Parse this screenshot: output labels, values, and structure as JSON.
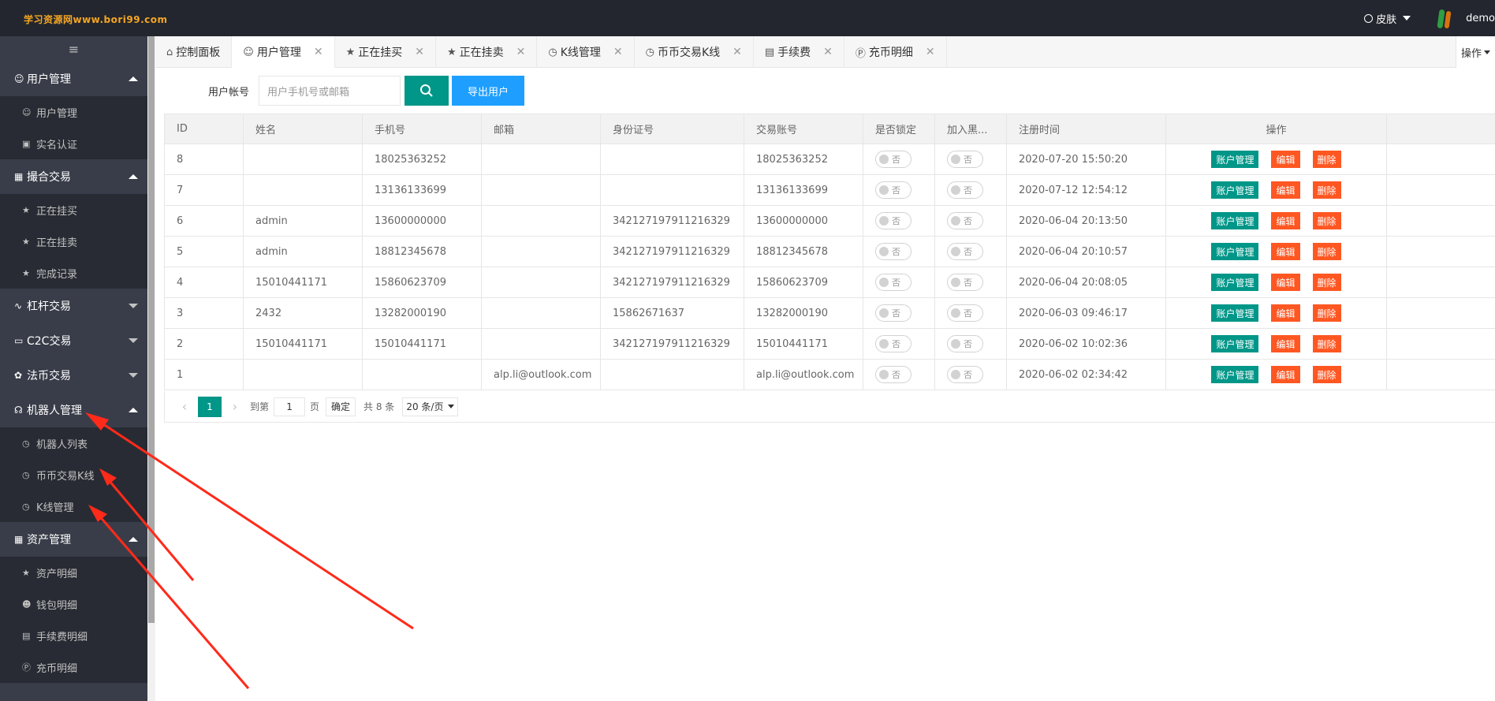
{
  "header": {
    "logo": "学习资源网www.bori99.com",
    "skin_label": "皮肤",
    "user": "demo"
  },
  "sidebar": {
    "toggle_icon": "≡",
    "groups": [
      {
        "label": "用户管理",
        "expanded": true,
        "items": [
          "用户管理",
          "实名认证"
        ]
      },
      {
        "label": "撮合交易",
        "expanded": true,
        "items": [
          "正在挂买",
          "正在挂卖",
          "完成记录"
        ]
      },
      {
        "label": "杠杆交易",
        "expanded": false,
        "items": []
      },
      {
        "label": "C2C交易",
        "expanded": false,
        "items": []
      },
      {
        "label": "法币交易",
        "expanded": false,
        "items": []
      },
      {
        "label": "机器人管理",
        "expanded": true,
        "items": [
          "机器人列表",
          "币币交易K线",
          "K线管理"
        ]
      },
      {
        "label": "资产管理",
        "expanded": true,
        "items": [
          "资产明细",
          "钱包明细",
          "手续费明细",
          "充币明细"
        ]
      }
    ]
  },
  "tabs": [
    {
      "label": "控制面板",
      "icon": "home-icon",
      "closable": false
    },
    {
      "label": "用户管理",
      "icon": "user-icon",
      "closable": true,
      "active": true
    },
    {
      "label": "正在挂买",
      "icon": "star-icon",
      "closable": true
    },
    {
      "label": "正在挂卖",
      "icon": "star-icon",
      "closable": true
    },
    {
      "label": "K线管理",
      "icon": "clock-icon",
      "closable": true
    },
    {
      "label": "币币交易K线",
      "icon": "clock-icon",
      "closable": true
    },
    {
      "label": "手续费",
      "icon": "note-icon",
      "closable": true
    },
    {
      "label": "充币明细",
      "icon": "dollar-icon",
      "closable": true
    }
  ],
  "tab_ops_label": "操作",
  "search": {
    "label": "用户帐号",
    "placeholder": "用户手机号或邮箱",
    "export_label": "导出用户"
  },
  "table": {
    "columns": [
      "ID",
      "姓名",
      "手机号",
      "邮箱",
      "身份证号",
      "交易账号",
      "是否锁定",
      "加入黑...",
      "注册时间",
      "操作"
    ],
    "toggle_off_label": "否",
    "ops": {
      "account": "账户管理",
      "edit": "编辑",
      "delete": "删除"
    },
    "rows": [
      {
        "id": "8",
        "name": "",
        "phone": "18025363252",
        "email": "",
        "idcard": "",
        "account": "18025363252",
        "registered": "2020-07-20 15:50:20"
      },
      {
        "id": "7",
        "name": "",
        "phone": "13136133699",
        "email": "",
        "idcard": "",
        "account": "13136133699",
        "registered": "2020-07-12 12:54:12"
      },
      {
        "id": "6",
        "name": "admin",
        "phone": "13600000000",
        "email": "",
        "idcard": "342127197911216329",
        "account": "13600000000",
        "registered": "2020-06-04 20:13:50"
      },
      {
        "id": "5",
        "name": "admin",
        "phone": "18812345678",
        "email": "",
        "idcard": "342127197911216329",
        "account": "18812345678",
        "registered": "2020-06-04 20:10:57"
      },
      {
        "id": "4",
        "name": "15010441171",
        "phone": "15860623709",
        "email": "",
        "idcard": "342127197911216329",
        "account": "15860623709",
        "registered": "2020-06-04 20:08:05"
      },
      {
        "id": "3",
        "name": "2432",
        "phone": "13282000190",
        "email": "",
        "idcard": "15862671637",
        "account": "13282000190",
        "registered": "2020-06-03 09:46:17"
      },
      {
        "id": "2",
        "name": "15010441171",
        "phone": "15010441171",
        "email": "",
        "idcard": "342127197911216329",
        "account": "15010441171",
        "registered": "2020-06-02 10:02:36"
      },
      {
        "id": "1",
        "name": "",
        "phone": "",
        "email": "alp.li@outlook.com",
        "idcard": "",
        "account": "alp.li@outlook.com",
        "registered": "2020-06-02 02:34:42"
      }
    ]
  },
  "pager": {
    "current": "1",
    "goto_label": "到第",
    "page_input": "1",
    "page_unit": "页",
    "confirm": "确定",
    "total": "共 8 条",
    "page_size": "20 条/页"
  },
  "colors": {
    "primary": "#009688",
    "danger": "#ff5722",
    "blue": "#1e9fff",
    "sidebar": "#393d49",
    "header": "#23262e",
    "arrow": "#ff2a1a"
  }
}
